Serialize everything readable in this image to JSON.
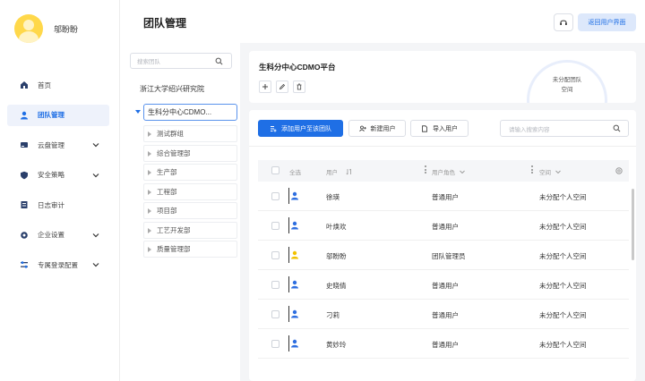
{
  "sidebar": {
    "user": {
      "name": "邬盼盼",
      "avatar_color": "#ffd84a"
    },
    "items": [
      {
        "label": "首页",
        "icon": "home-icon",
        "active": false,
        "expandable": false
      },
      {
        "label": "团队管理",
        "icon": "user-icon",
        "active": true,
        "expandable": false
      },
      {
        "label": "云盘管理",
        "icon": "drive-icon",
        "active": false,
        "expandable": true
      },
      {
        "label": "安全策略",
        "icon": "shield-icon",
        "active": false,
        "expandable": true
      },
      {
        "label": "日志审计",
        "icon": "log-icon",
        "active": false,
        "expandable": false
      },
      {
        "label": "企业设置",
        "icon": "settings-icon",
        "active": false,
        "expandable": true
      },
      {
        "label": "专属登录配置",
        "icon": "config-icon",
        "active": false,
        "expandable": true
      }
    ]
  },
  "header": {
    "title": "团队管理",
    "back_label": "返回用户界面",
    "headset_icon": "headset-icon"
  },
  "tree": {
    "search_placeholder": "搜索团队",
    "root": "浙江大学绍兴研究院",
    "selected": "生科分中心CDMO...",
    "children": [
      "测试群组",
      "综合管理部",
      "生产部",
      "工程部",
      "项目部",
      "工艺开发部",
      "质量管理部"
    ]
  },
  "team_info": {
    "name": "生科分中心CDMO平台",
    "unassigned_line1": "未分配团队",
    "unassigned_line2": "空间"
  },
  "toolbar": {
    "add_users": "添加用户至该团队",
    "new_user": "新建用户",
    "import_users": "导入用户",
    "search_placeholder": "请输入搜索内容"
  },
  "table": {
    "headers": {
      "select_all": "全选",
      "user": "用户",
      "role": "用户角色",
      "space": "空间"
    },
    "rows": [
      {
        "name": "徐瑛",
        "role": "普通用户",
        "space": "未分配个人空间",
        "icon_color": "#2f6fe0"
      },
      {
        "name": "叶焕欢",
        "role": "普通用户",
        "space": "未分配个人空间",
        "icon_color": "#2f6fe0"
      },
      {
        "name": "邬盼盼",
        "role": "团队管理员",
        "space": "未分配个人空间",
        "icon_color": "#f2c200"
      },
      {
        "name": "史晓倩",
        "role": "普通用户",
        "space": "未分配个人空间",
        "icon_color": "#2f6fe0"
      },
      {
        "name": "刁莉",
        "role": "普通用户",
        "space": "未分配个人空间",
        "icon_color": "#2f6fe0"
      },
      {
        "name": "黄妙玲",
        "role": "普通用户",
        "space": "未分配个人空间",
        "icon_color": "#2f6fe0"
      }
    ]
  },
  "colors": {
    "accent": "#1f6fe5",
    "active_bg": "#eef2fb"
  }
}
